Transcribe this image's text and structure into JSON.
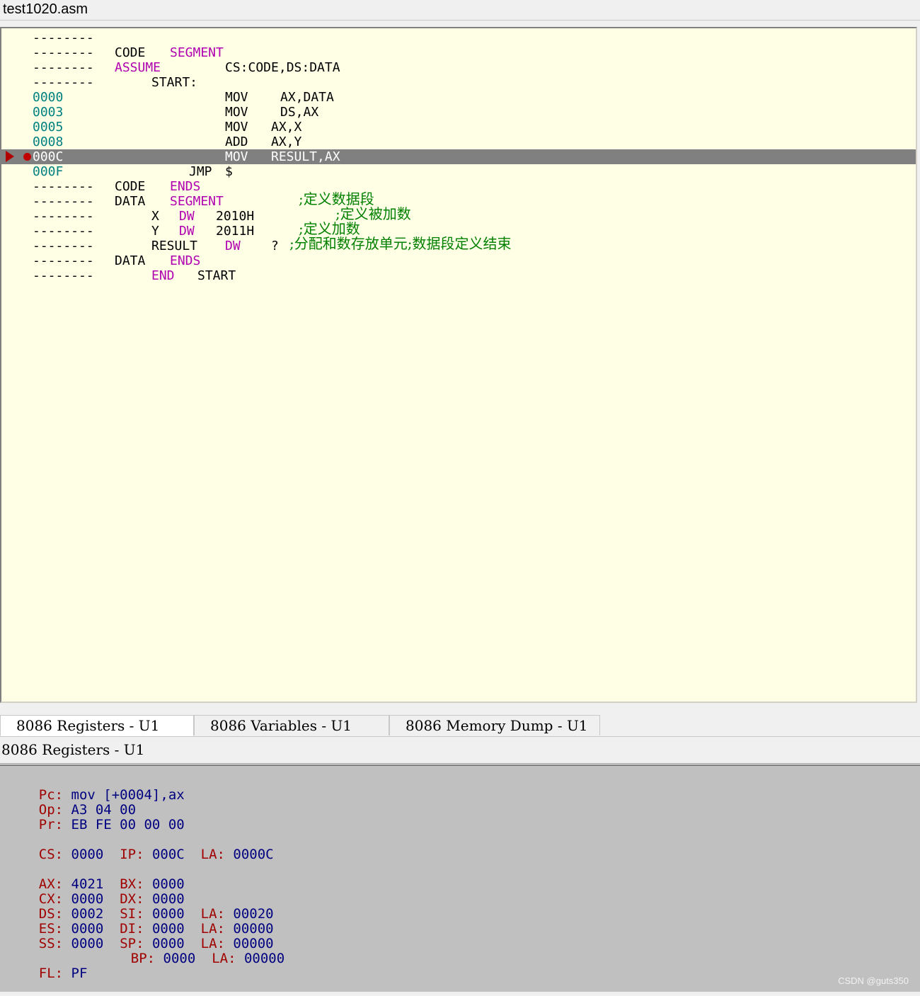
{
  "window": {
    "title": "test1020.asm"
  },
  "editor": {
    "lines": [
      {
        "addr": "--------",
        "c1": "",
        "c2": "",
        "c3": ""
      },
      {
        "addr": "--------",
        "c1": "CODE",
        "c2": "SEGMENT",
        "c3": ""
      },
      {
        "addr": "--------",
        "c1": "ASSUME",
        "c2": "CS:CODE,DS:DATA",
        "c3": ""
      },
      {
        "addr": "--------",
        "c1": "START:",
        "c2": "",
        "c3": ""
      },
      {
        "addr": "0000",
        "c1": "MOV",
        "c2": "AX,DATA",
        "c3": ""
      },
      {
        "addr": "0003",
        "c1": "MOV",
        "c2": "DS,AX",
        "c3": ""
      },
      {
        "addr": "0005",
        "c1": "MOV",
        "c2": "AX,X",
        "c3": ""
      },
      {
        "addr": "0008",
        "c1": "ADD",
        "c2": "AX,Y",
        "c3": ""
      },
      {
        "addr": "000C",
        "c1": "MOV",
        "c2": "RESULT,AX",
        "c3": ""
      },
      {
        "addr": "000F",
        "c1": "JMP",
        "c2": "$",
        "c3": ""
      },
      {
        "addr": "--------",
        "c1": "CODE",
        "c2": "ENDS",
        "c3": ""
      },
      {
        "addr": "--------",
        "c1": "DATA",
        "c2": "SEGMENT",
        "c3": ";定义数据段"
      },
      {
        "addr": "--------",
        "c1": "X",
        "c2": "DW",
        "c3": "2010H",
        "c4": ";定义被加数"
      },
      {
        "addr": "--------",
        "c1": "Y",
        "c2": "DW",
        "c3": "2011H",
        "c4": ";定义加数"
      },
      {
        "addr": "--------",
        "c1": "RESULT",
        "c2": "DW",
        "c3": "?",
        "c4": ";分配和数存放单元;数据段定义结束"
      },
      {
        "addr": "--------",
        "c1": "DATA",
        "c2": "ENDS",
        "c3": ""
      },
      {
        "addr": "--------",
        "c1": "END",
        "c2": "START",
        "c3": ""
      }
    ],
    "current_line_index": 8,
    "colors": {
      "background": "#ffffe6",
      "address": "#008080",
      "keyword": "#b000b0",
      "comment": "#008000",
      "current_line": "#808080"
    }
  },
  "tabs": [
    {
      "label": "8086 Registers - U1",
      "active": true
    },
    {
      "label": "8086 Variables - U1",
      "active": false
    },
    {
      "label": "8086 Memory Dump - U1",
      "active": false
    }
  ],
  "panel": {
    "title": "8086 Registers - U1"
  },
  "registers": {
    "pc": {
      "label": "Pc:",
      "value": "mov [+0004],ax"
    },
    "op": {
      "label": "Op:",
      "value": "A3 04 00"
    },
    "pr": {
      "label": "Pr:",
      "value": "EB FE 00 00 00"
    },
    "cs": {
      "label": "CS:",
      "value": "0000"
    },
    "ip": {
      "label": "IP:",
      "value": "000C"
    },
    "cs_la": {
      "label": "LA:",
      "value": "0000C"
    },
    "ax": {
      "label": "AX:",
      "value": "4021"
    },
    "bx": {
      "label": "BX:",
      "value": "0000"
    },
    "cx": {
      "label": "CX:",
      "value": "0000"
    },
    "dx": {
      "label": "DX:",
      "value": "0000"
    },
    "ds": {
      "label": "DS:",
      "value": "0002"
    },
    "si": {
      "label": "SI:",
      "value": "0000"
    },
    "si_la": {
      "label": "LA:",
      "value": "00020"
    },
    "es": {
      "label": "ES:",
      "value": "0000"
    },
    "di": {
      "label": "DI:",
      "value": "0000"
    },
    "di_la": {
      "label": "LA:",
      "value": "00000"
    },
    "ss": {
      "label": "SS:",
      "value": "0000"
    },
    "sp": {
      "label": "SP:",
      "value": "0000"
    },
    "sp_la": {
      "label": "LA:",
      "value": "00000"
    },
    "bp": {
      "label": "BP:",
      "value": "0000"
    },
    "bp_la": {
      "label": "LA:",
      "value": "00000"
    },
    "fl": {
      "label": "FL:",
      "value": "PF"
    }
  },
  "watermark": "CSDN @guts350"
}
